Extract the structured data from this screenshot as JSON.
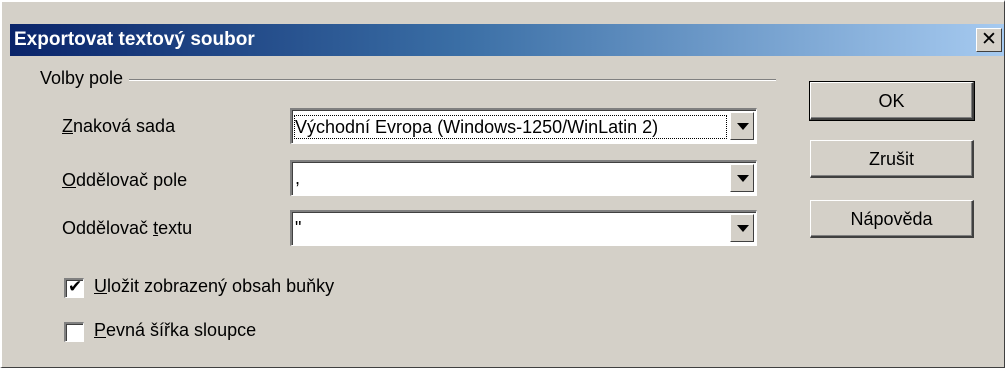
{
  "dialog": {
    "title": "Exportovat textový soubor",
    "close_symbol": "✕",
    "close_icon": "close-icon"
  },
  "field_options": {
    "group_label": "Volby pole",
    "charset": {
      "label_prefix": "",
      "label_mnemonic": "Z",
      "label_rest": "naková sada",
      "value": "Východní Evropa (Windows-1250/WinLatin 2)"
    },
    "field_separator": {
      "label_prefix": "",
      "label_mnemonic": "O",
      "label_rest": "ddělovač pole",
      "value": ","
    },
    "text_separator": {
      "label_prefix": "Oddělovač ",
      "label_mnemonic": "t",
      "label_rest": "extu",
      "value": "\""
    },
    "save_cell_content": {
      "checked": true,
      "label_mnemonic": "U",
      "label_rest": "ložit zobrazený obsah buňky"
    },
    "fixed_column_width": {
      "checked": false,
      "label_mnemonic": "P",
      "label_rest": "evná šířka sloupce"
    }
  },
  "buttons": {
    "ok": "OK",
    "cancel": "Zrušit",
    "help": "Nápověda"
  },
  "colors": {
    "title_start": "#0a246a",
    "title_end": "#a6caf0",
    "face": "#d4d0c8"
  }
}
